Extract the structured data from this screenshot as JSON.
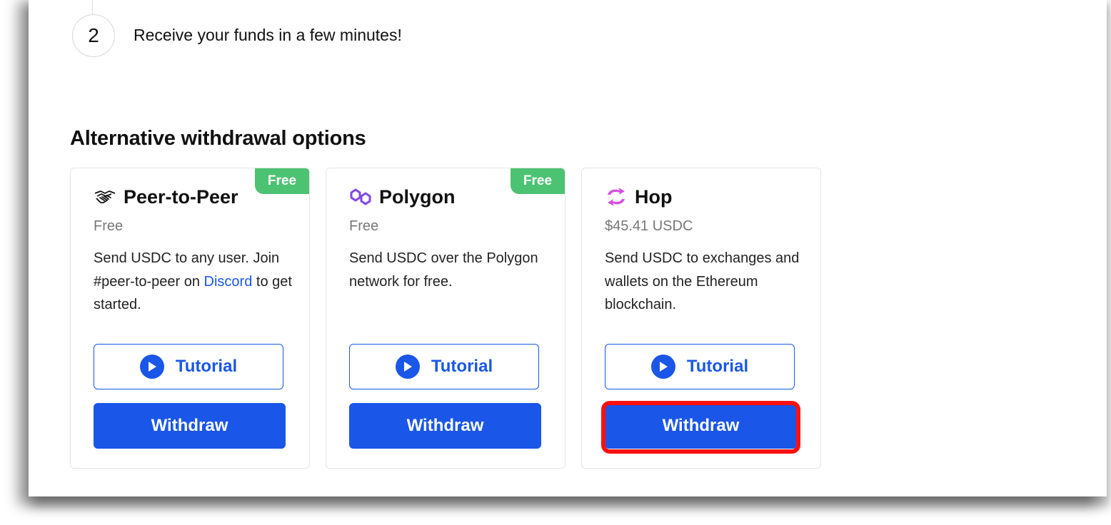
{
  "step": {
    "number": "2",
    "text": "Receive your funds in a few minutes!"
  },
  "section": {
    "title": "Alternative withdrawal options"
  },
  "cards": [
    {
      "icon": "handshake-icon",
      "title": "Peer-to-Peer",
      "badge": "Free",
      "price": "Free",
      "desc_prefix": "Send USDC to any user. Join #peer-to-peer on ",
      "desc_link": "Discord",
      "desc_suffix": " to get started.",
      "tutorial_label": "Tutorial",
      "withdraw_label": "Withdraw"
    },
    {
      "icon": "polygon-icon",
      "title": "Polygon",
      "badge": "Free",
      "price": "Free",
      "desc": "Send USDC over the Polygon network for free.",
      "tutorial_label": "Tutorial",
      "withdraw_label": "Withdraw"
    },
    {
      "icon": "hop-icon",
      "title": "Hop",
      "price": "$45.41 USDC",
      "desc": "Send USDC to exchanges and wallets on the Ethereum blockchain.",
      "tutorial_label": "Tutorial",
      "withdraw_label": "Withdraw"
    }
  ],
  "colors": {
    "accent": "#1a56e8",
    "badge": "#4cc273",
    "highlight": "#ff1010",
    "polygon": "#8247e5",
    "hop": "#d54fe0"
  }
}
